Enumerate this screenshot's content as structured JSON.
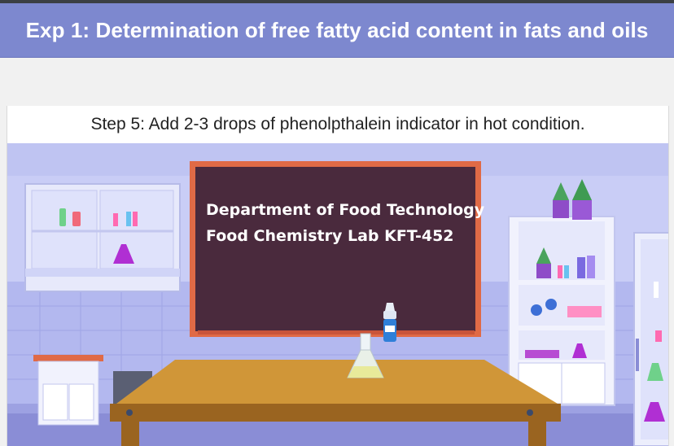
{
  "header": {
    "title": "Exp 1: Determination of free fatty acid content in fats and oils"
  },
  "step": {
    "instruction": "Step 5: Add 2-3 drops of phenolpthalein indicator in hot condition."
  },
  "scene": {
    "board": {
      "line1": "Department of Food Technology",
      "line2": "Food Chemistry Lab  KFT-452"
    },
    "colors": {
      "wall": "#c9cdf6",
      "wall_tiles": "#aeb4ee",
      "floor": "#8a8dd6",
      "board": "#4a2a3d",
      "board_frame": "#e06a46",
      "table_top": "#d09638",
      "table_front": "#9a6420"
    }
  }
}
